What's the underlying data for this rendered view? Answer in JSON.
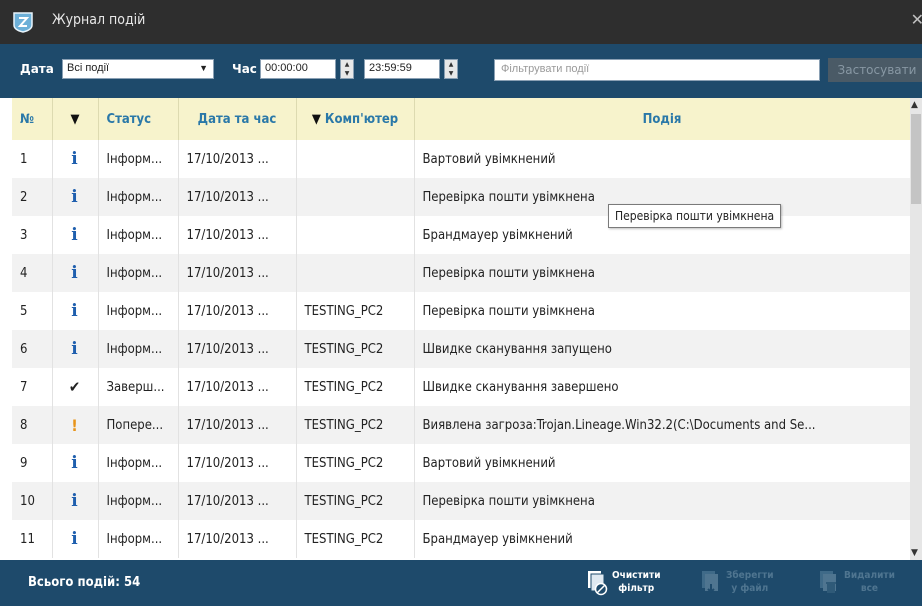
{
  "window": {
    "title": "Журнал подій"
  },
  "toolbar": {
    "date_label": "Дата",
    "date_value": "Всі події",
    "time_label": "Час",
    "time_from": "00:00:00",
    "time_to": "23:59:59",
    "filter_placeholder": "Фільтрувати події",
    "apply_label": "Застосувати"
  },
  "table": {
    "headers": {
      "num": "№",
      "status": "Статус",
      "datetime": "Дата та час",
      "computer": "Комп'ютер",
      "event": "Подія"
    },
    "rows": [
      {
        "num": "1",
        "status_icon": "info-icon",
        "status": "Інформ...",
        "datetime": "17/10/2013 ...",
        "computer": "",
        "event": "Вартовий увімкнений"
      },
      {
        "num": "2",
        "status_icon": "info-icon",
        "status": "Інформ...",
        "datetime": "17/10/2013 ...",
        "computer": "",
        "event": "Перевірка пошти увімкнена"
      },
      {
        "num": "3",
        "status_icon": "info-icon",
        "status": "Інформ...",
        "datetime": "17/10/2013 ...",
        "computer": "",
        "event": "Брандмауер увімкнений"
      },
      {
        "num": "4",
        "status_icon": "info-icon",
        "status": "Інформ...",
        "datetime": "17/10/2013 ...",
        "computer": "",
        "event": "Перевірка пошти увімкнена"
      },
      {
        "num": "5",
        "status_icon": "info-icon",
        "status": "Інформ...",
        "datetime": "17/10/2013 ...",
        "computer": "TESTING_PC2",
        "event": "Перевірка пошти увімкнена"
      },
      {
        "num": "6",
        "status_icon": "info-icon",
        "status": "Інформ...",
        "datetime": "17/10/2013 ...",
        "computer": "TESTING_PC2",
        "event": "Швидке сканування запущено"
      },
      {
        "num": "7",
        "status_icon": "checkmark-icon",
        "status": "Заверш...",
        "datetime": "17/10/2013 ...",
        "computer": "TESTING_PC2",
        "event": "Швидке сканування завершено"
      },
      {
        "num": "8",
        "status_icon": "warning-icon",
        "status": "Попере...",
        "datetime": "17/10/2013 ...",
        "computer": "TESTING_PC2",
        "event": "Виявлена загроза:Trojan.Lineage.Win32.2(C:\\Documents and Se..."
      },
      {
        "num": "9",
        "status_icon": "info-icon",
        "status": "Інформ...",
        "datetime": "17/10/2013 ...",
        "computer": "TESTING_PC2",
        "event": "Вартовий увімкнений"
      },
      {
        "num": "10",
        "status_icon": "info-icon",
        "status": "Інформ...",
        "datetime": "17/10/2013 ...",
        "computer": "TESTING_PC2",
        "event": "Перевірка пошти увімкнена"
      },
      {
        "num": "11",
        "status_icon": "info-icon",
        "status": "Інформ...",
        "datetime": "17/10/2013 ...",
        "computer": "TESTING_PC2",
        "event": "Брандмауер увімкнений"
      }
    ]
  },
  "tooltip": {
    "text": "Перевірка пошти увімкнена"
  },
  "footer": {
    "total": "Всього подій: 54",
    "clear_filter": {
      "line1": "Очистити",
      "line2": "фільтр"
    },
    "save_file": {
      "line1": "Зберегти",
      "line2": "у файл"
    },
    "delete_all": {
      "line1": "Видалити",
      "line2": "все"
    }
  },
  "colors": {
    "header_bg": "#1e4a6b",
    "titlebar_bg": "#2e2e2e",
    "column_header_bg": "#f7f3cc",
    "column_header_text": "#2a78a8",
    "info_icon": "#1f5fae",
    "warning_icon": "#e8941a"
  }
}
